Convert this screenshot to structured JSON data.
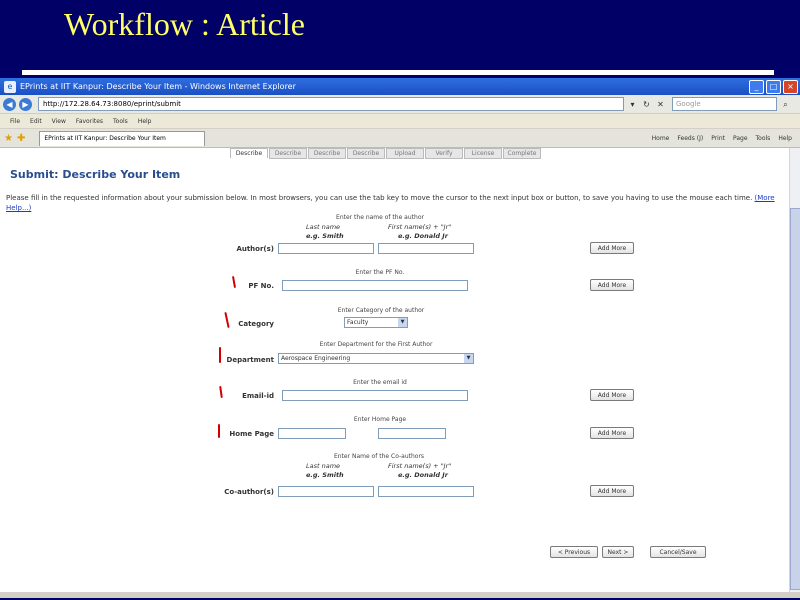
{
  "slide": {
    "title": "Workflow : Article"
  },
  "browser": {
    "window_title": "EPrints at IIT Kanpur: Describe Your Item - Windows Internet Explorer",
    "address": "http://172.28.64.73:8080/eprint/submit",
    "search_placeholder": "Google",
    "menu": [
      "File",
      "Edit",
      "View",
      "Favorites",
      "Tools",
      "Help"
    ],
    "tab_label": "EPrints at IIT Kanpur: Describe Your Item",
    "tools": [
      "Home",
      "Feeds (J)",
      "Print",
      "Page",
      "Tools",
      "Help"
    ]
  },
  "steps": [
    "Describe",
    "Describe",
    "Describe",
    "Describe",
    "Upload",
    "Verify",
    "License",
    "Complete"
  ],
  "page": {
    "heading": "Submit: Describe Your Item",
    "intro": "Please fill in the requested information about your submission below. In most browsers, you can use the tab key to move the cursor to the next input box or button, to save you having to use the mouse each time.",
    "more_help": "(More Help...)"
  },
  "form": {
    "authors_hint": "Enter the name of the author",
    "last_name_hint": "Last name",
    "first_name_hint": "First name(s) + \"Jr\"",
    "eg_last": "e.g. Smith",
    "eg_first": "e.g. Donald Jr",
    "authors_label": "Author(s)",
    "pf_hint": "Enter the PF No.",
    "pf_label": "PF No.",
    "category_hint": "Enter Category of the author",
    "category_label": "Category",
    "category_value": "Faculty",
    "department_hint": "Enter Department for the First Author",
    "department_label": "Department",
    "department_value": "Aerospace Engineering",
    "email_hint": "Enter the email id",
    "email_label": "Email-id",
    "homepage_hint": "Enter Home Page",
    "homepage_label": "Home Page",
    "coauthors_hint": "Enter Name of the Co-authors",
    "coauthors_label": "Co-author(s)",
    "add_more": "Add More",
    "previous": "< Previous",
    "next": "Next >",
    "cancel_save": "Cancel/Save"
  }
}
